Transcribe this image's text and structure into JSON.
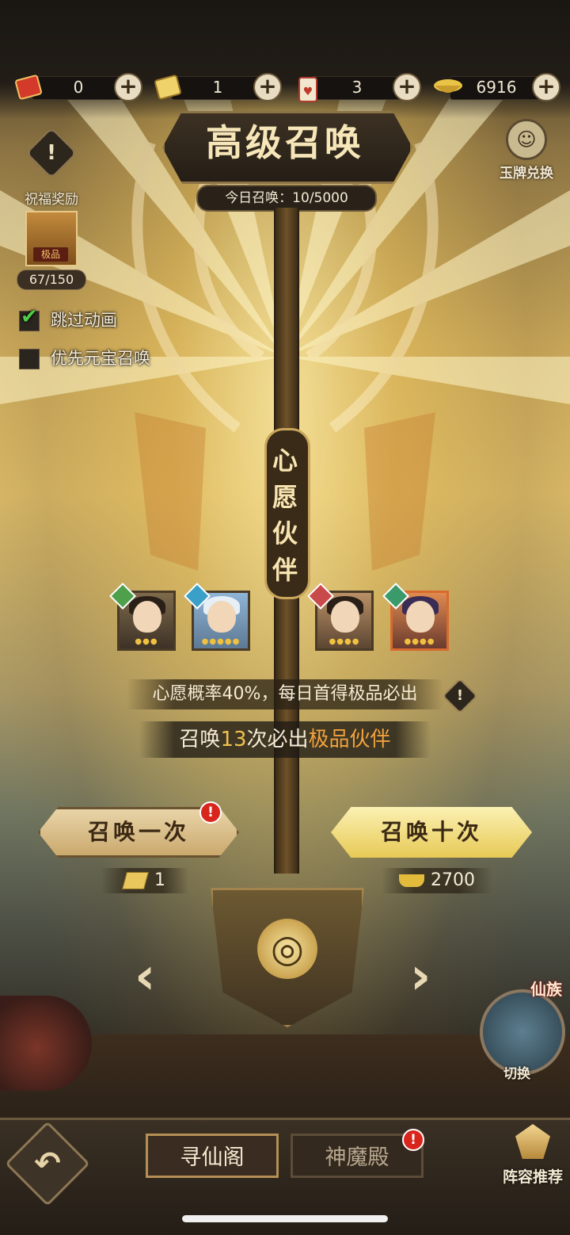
{
  "resources": [
    {
      "icon": "red-envelope-icon",
      "value": "0"
    },
    {
      "icon": "summon-ticket-icon",
      "value": "1"
    },
    {
      "icon": "heart-charm-icon",
      "value": "3"
    },
    {
      "icon": "gold-ingot-icon",
      "value": "6916"
    }
  ],
  "header": {
    "title": "高级召唤",
    "daily_summons": "今日召唤：10/5000",
    "exchange_label": "玉牌兑换"
  },
  "blessing": {
    "label": "祝福奖励",
    "reward_tag": "极品",
    "progress": "67/150"
  },
  "options": {
    "skip_animation": {
      "label": "跳过动画",
      "checked": true
    },
    "prefer_ingot": {
      "label": "优先元宝召唤",
      "checked": false
    }
  },
  "wish": {
    "banner_chars": [
      "心",
      "愿",
      "伙",
      "伴"
    ],
    "rate_text": "心愿概率40%，每日首得极品必出"
  },
  "guarantee": {
    "prefix": "召唤",
    "count": "13",
    "middle": "次必出",
    "highlight": "极品伙伴"
  },
  "summon": {
    "once": {
      "label": "召唤一次",
      "cost": "1",
      "cost_icon": "summon-ticket-icon",
      "alert": "!"
    },
    "ten": {
      "label": "召唤十次",
      "cost": "2700",
      "cost_icon": "gold-ingot-icon"
    }
  },
  "switcher": {
    "top_label": "仙族",
    "bottom_label": "切换"
  },
  "bottom": {
    "tabs": [
      {
        "label": "寻仙阁",
        "active": true
      },
      {
        "label": "神魔殿",
        "active": false,
        "alert": "!"
      }
    ],
    "lineup_label": "阵容推荐"
  },
  "colors": {
    "accent_gold": "#f2c14e",
    "highlight_orange": "#f2a23c",
    "alert_red": "#d8261c"
  }
}
